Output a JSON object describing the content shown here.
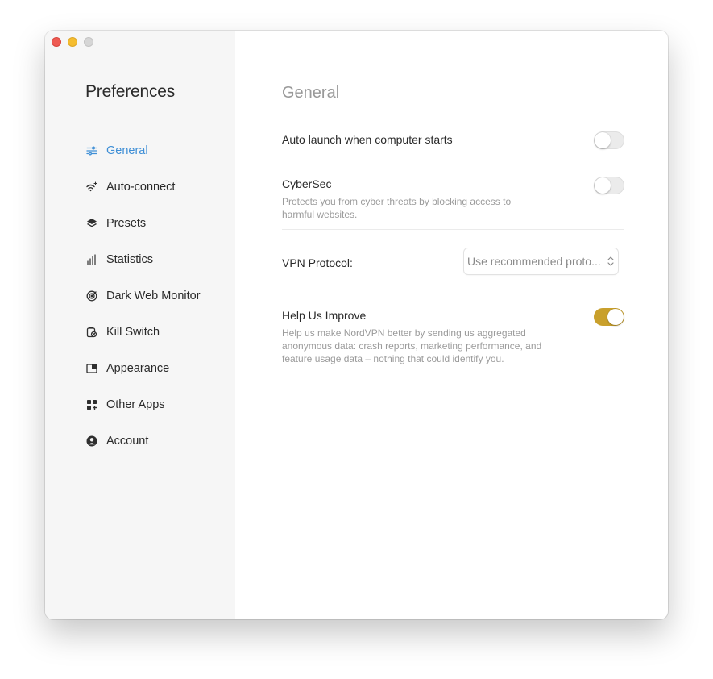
{
  "window": {
    "traffic_lights": [
      "close",
      "minimize",
      "zoom"
    ]
  },
  "sidebar": {
    "title": "Preferences",
    "items": [
      {
        "label": "General",
        "icon": "sliders-icon",
        "active": true
      },
      {
        "label": "Auto-connect",
        "icon": "wifi-sparkle-icon",
        "active": false
      },
      {
        "label": "Presets",
        "icon": "layers-icon",
        "active": false
      },
      {
        "label": "Statistics",
        "icon": "bars-icon",
        "active": false
      },
      {
        "label": "Dark Web Monitor",
        "icon": "radar-icon",
        "active": false
      },
      {
        "label": "Kill Switch",
        "icon": "kill-switch-icon",
        "active": false
      },
      {
        "label": "Appearance",
        "icon": "window-icon",
        "active": false
      },
      {
        "label": "Other Apps",
        "icon": "grid-plus-icon",
        "active": false
      },
      {
        "label": "Account",
        "icon": "user-circle-icon",
        "active": false
      }
    ]
  },
  "main": {
    "title": "General",
    "auto_launch": {
      "label": "Auto launch when computer starts",
      "enabled": false
    },
    "cybersec": {
      "label": "CyberSec",
      "description": "Protects you from cyber threats by blocking access to harmful websites.",
      "enabled": false
    },
    "vpn_protocol": {
      "label": "VPN Protocol:",
      "value": "Use recommended proto..."
    },
    "help_improve": {
      "label": "Help Us Improve",
      "description": "Help us make NordVPN better by sending us aggregated anonymous data: crash reports, marketing performance, and feature usage data – nothing that could identify you.",
      "enabled": true
    }
  },
  "colors": {
    "accent": "#3f8fd6",
    "toggle_on": "#c9a02c",
    "sidebar_bg": "#f6f6f6"
  }
}
